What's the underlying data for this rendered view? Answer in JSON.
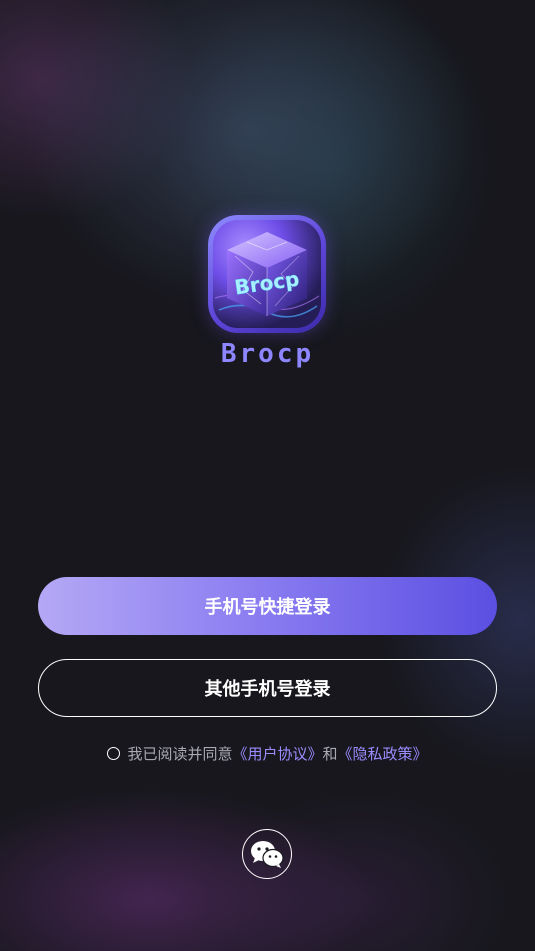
{
  "app": {
    "brand_name": "Brocp",
    "logo_text": "Brocp"
  },
  "login": {
    "quick_login_label": "手机号快捷登录",
    "other_phone_login_label": "其他手机号登录"
  },
  "agreement": {
    "prefix": "我已阅读并同意",
    "user_agreement_link": "《用户协议》",
    "conjunction": "和",
    "privacy_policy_link": "《隐私政策》",
    "checked": false
  },
  "social_login": {
    "icon": "wechat-icon"
  },
  "colors": {
    "accent": "#9b8cff",
    "brand": "#8e86ff",
    "primary_gradient_start": "#b4a8f5",
    "primary_gradient_end": "#5b4fe2",
    "background": "#17171d"
  }
}
